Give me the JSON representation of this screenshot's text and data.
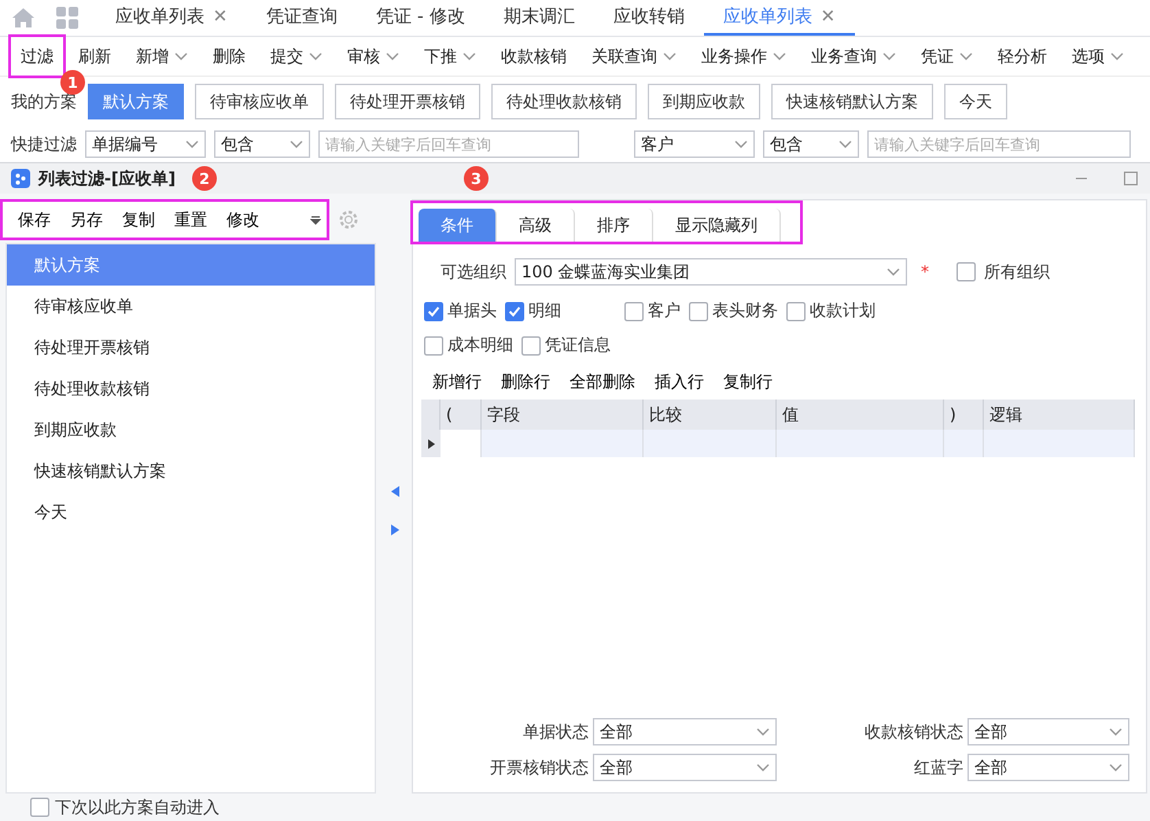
{
  "nav_tabs": [
    {
      "label": "应收单列表",
      "close": "✕",
      "selected": false
    },
    {
      "label": "凭证查询",
      "selected": false
    },
    {
      "label": "凭证 - 修改",
      "selected": false
    },
    {
      "label": "期末调汇",
      "selected": false
    },
    {
      "label": "应收转销",
      "selected": false
    },
    {
      "label": "应收单列表",
      "close": "✕",
      "selected": true
    }
  ],
  "toolbar": [
    {
      "label": "过滤",
      "dropdown": false,
      "highlighted": true,
      "badge": "1"
    },
    {
      "label": "刷新",
      "dropdown": false,
      "highlighted": false
    },
    {
      "label": "新增",
      "dropdown": true,
      "highlighted": false
    },
    {
      "label": "删除",
      "dropdown": false,
      "highlighted": false
    },
    {
      "label": "提交",
      "dropdown": true,
      "highlighted": false
    },
    {
      "label": "审核",
      "dropdown": true,
      "highlighted": false
    },
    {
      "label": "下推",
      "dropdown": true,
      "highlighted": false
    },
    {
      "label": "收款核销",
      "dropdown": false,
      "highlighted": false
    },
    {
      "label": "关联查询",
      "dropdown": true,
      "highlighted": false
    },
    {
      "label": "业务操作",
      "dropdown": true,
      "highlighted": false
    },
    {
      "label": "业务查询",
      "dropdown": true,
      "highlighted": false
    },
    {
      "label": "凭证",
      "dropdown": true,
      "highlighted": false
    },
    {
      "label": "轻分析",
      "dropdown": false,
      "highlighted": false
    },
    {
      "label": "选项",
      "dropdown": true,
      "highlighted": false
    }
  ],
  "schemes": {
    "label": "我的方案",
    "items": [
      {
        "label": "默认方案",
        "selected": true
      },
      {
        "label": "待审核应收单",
        "selected": false
      },
      {
        "label": "待处理开票核销",
        "selected": false
      },
      {
        "label": "待处理收款核销",
        "selected": false
      },
      {
        "label": "到期应收款",
        "selected": false
      },
      {
        "label": "快速核销默认方案",
        "selected": false
      },
      {
        "label": "今天",
        "selected": false
      }
    ]
  },
  "quick_filter": {
    "label": "快捷过滤",
    "groups": [
      {
        "field": "单据编号",
        "operator": "包含",
        "placeholder": "请输入关键字后回车查询"
      },
      {
        "field": "客户",
        "operator": "包含",
        "placeholder": "请输入关键字后回车查询"
      }
    ]
  },
  "dialog": {
    "title": "列表过滤-[应收单]",
    "title_badge": "2",
    "tabs_badge": "3",
    "left_toolbar": {
      "highlighted": true,
      "actions": [
        "保存",
        "另存",
        "复制",
        "重置",
        "修改"
      ]
    },
    "scheme_list": [
      {
        "label": "默认方案",
        "selected": true
      },
      {
        "label": "待审核应收单",
        "selected": false
      },
      {
        "label": "待处理开票核销",
        "selected": false
      },
      {
        "label": "待处理收款核销",
        "selected": false
      },
      {
        "label": "到期应收款",
        "selected": false
      },
      {
        "label": "快速核销默认方案",
        "selected": false
      },
      {
        "label": "今天",
        "selected": false
      }
    ],
    "tabs": {
      "highlighted": true,
      "items": [
        {
          "label": "条件",
          "selected": true
        },
        {
          "label": "高级",
          "selected": false
        },
        {
          "label": "排序",
          "selected": false
        },
        {
          "label": "显示隐藏列",
          "selected": false
        }
      ]
    },
    "org": {
      "label": "可选组织",
      "value": "100 金蝶蓝海实业集团",
      "required": "*",
      "all_orgs": {
        "label": "所有组织",
        "checked": false
      }
    },
    "checkboxes": [
      {
        "label": "单据头",
        "checked": true
      },
      {
        "label": "明细",
        "checked": true
      },
      {
        "label": "客户",
        "checked": false
      },
      {
        "label": "表头财务",
        "checked": false
      },
      {
        "label": "收款计划",
        "checked": false
      },
      {
        "label": "成本明细",
        "checked": false
      },
      {
        "label": "凭证信息",
        "checked": false
      }
    ],
    "grid_actions": [
      "新增行",
      "删除行",
      "全部删除",
      "插入行",
      "复制行"
    ],
    "grid_columns": [
      "(",
      "字段",
      "比较",
      "值",
      ")",
      "逻辑"
    ],
    "status_fields": [
      {
        "label": "单据状态",
        "value": "全部"
      },
      {
        "label": "收款核销状态",
        "value": "全部"
      },
      {
        "label": "开票核销状态",
        "value": "全部"
      },
      {
        "label": "红蓝字",
        "value": "全部"
      }
    ],
    "auto_enter": {
      "label": "下次以此方案自动进入",
      "checked": false
    }
  }
}
